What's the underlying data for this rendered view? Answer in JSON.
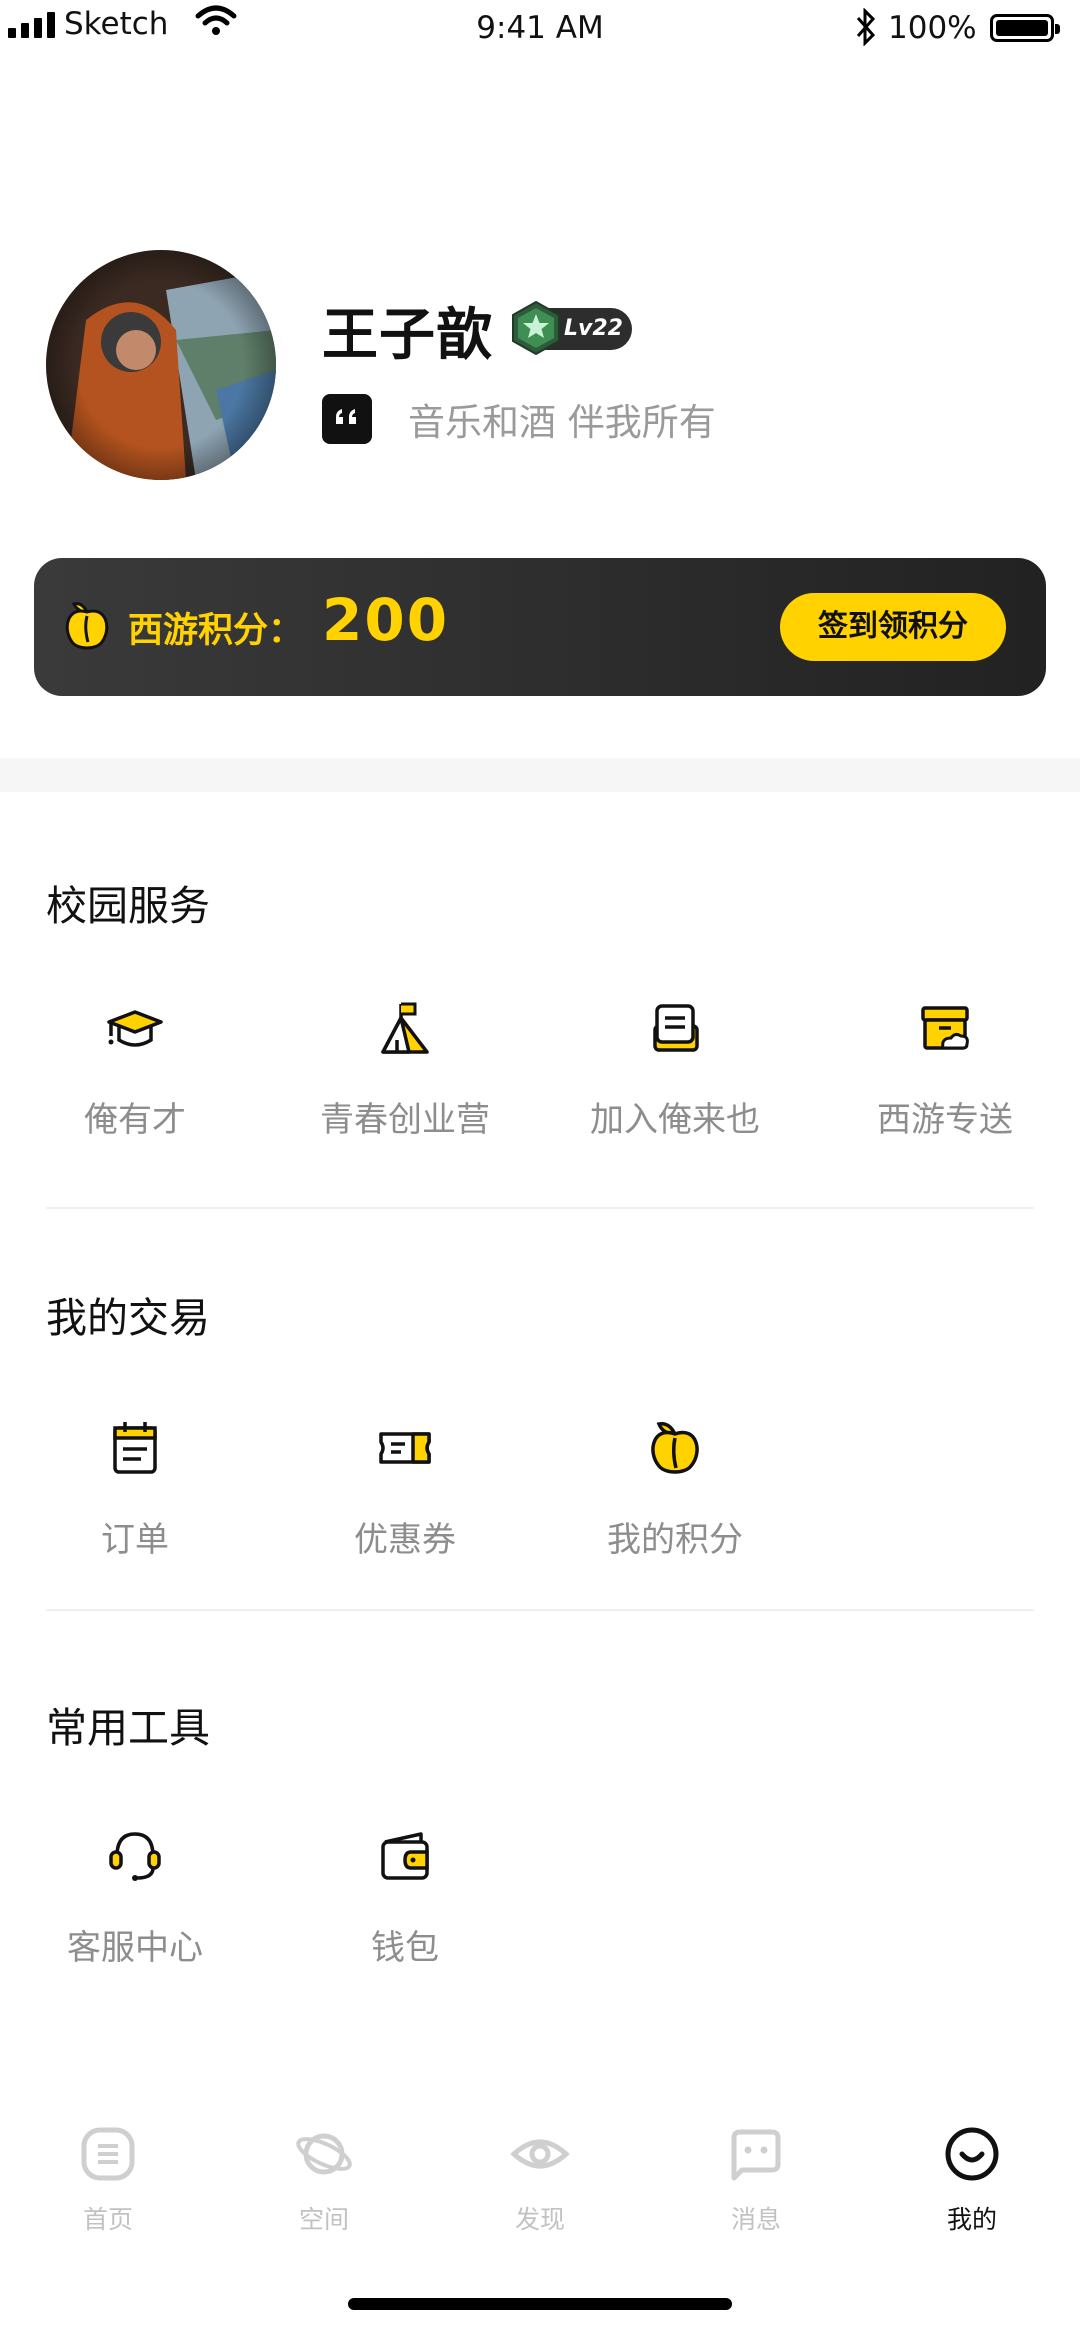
{
  "status_bar": {
    "carrier": "Sketch",
    "time": "9:41 AM",
    "battery": "100%"
  },
  "profile": {
    "name": "王子歆",
    "level": "Lv22",
    "motto": "音乐和酒 伴我所有"
  },
  "points": {
    "label": "西游积分：",
    "value": "200",
    "sign_in_button": "签到领积分"
  },
  "sections": {
    "campus": {
      "title": "校园服务",
      "items": [
        {
          "label": "俺有才",
          "icon": "graduation-cap-icon"
        },
        {
          "label": "青春创业营",
          "icon": "tent-icon"
        },
        {
          "label": "加入俺来也",
          "icon": "document-box-icon"
        },
        {
          "label": "西游专送",
          "icon": "delivery-box-icon"
        }
      ]
    },
    "trade": {
      "title": "我的交易",
      "items": [
        {
          "label": "订单",
          "icon": "calendar-order-icon"
        },
        {
          "label": "优惠券",
          "icon": "coupon-icon"
        },
        {
          "label": "我的积分",
          "icon": "peach-icon"
        }
      ]
    },
    "tools": {
      "title": "常用工具",
      "items": [
        {
          "label": "客服中心",
          "icon": "headset-icon"
        },
        {
          "label": "钱包",
          "icon": "wallet-icon"
        }
      ]
    }
  },
  "tab_bar": {
    "items": [
      {
        "label": "首页",
        "icon": "home-icon",
        "active": false
      },
      {
        "label": "空间",
        "icon": "planet-icon",
        "active": false
      },
      {
        "label": "发现",
        "icon": "eye-icon",
        "active": false
      },
      {
        "label": "消息",
        "icon": "message-icon",
        "active": false
      },
      {
        "label": "我的",
        "icon": "smile-icon",
        "active": true
      }
    ]
  },
  "colors": {
    "accent": "#ffd200",
    "banner_dark": "#222222",
    "text_muted": "#8d8d8d",
    "tab_inactive": "#c2c2c2"
  }
}
